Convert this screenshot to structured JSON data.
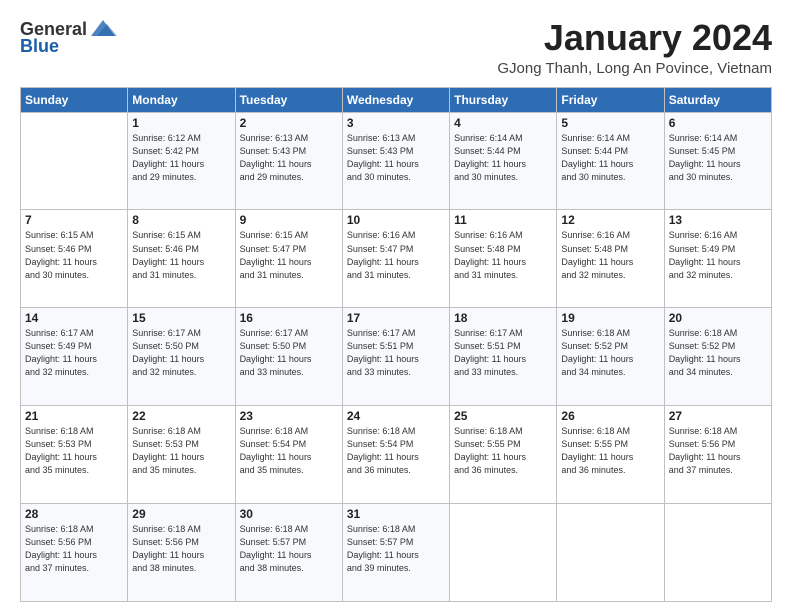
{
  "logo": {
    "general": "General",
    "blue": "Blue"
  },
  "header": {
    "month": "January 2024",
    "location": "GJong Thanh, Long An Povince, Vietnam"
  },
  "weekdays": [
    "Sunday",
    "Monday",
    "Tuesday",
    "Wednesday",
    "Thursday",
    "Friday",
    "Saturday"
  ],
  "weeks": [
    [
      {
        "day": "",
        "info": ""
      },
      {
        "day": "1",
        "info": "Sunrise: 6:12 AM\nSunset: 5:42 PM\nDaylight: 11 hours\nand 29 minutes."
      },
      {
        "day": "2",
        "info": "Sunrise: 6:13 AM\nSunset: 5:43 PM\nDaylight: 11 hours\nand 29 minutes."
      },
      {
        "day": "3",
        "info": "Sunrise: 6:13 AM\nSunset: 5:43 PM\nDaylight: 11 hours\nand 30 minutes."
      },
      {
        "day": "4",
        "info": "Sunrise: 6:14 AM\nSunset: 5:44 PM\nDaylight: 11 hours\nand 30 minutes."
      },
      {
        "day": "5",
        "info": "Sunrise: 6:14 AM\nSunset: 5:44 PM\nDaylight: 11 hours\nand 30 minutes."
      },
      {
        "day": "6",
        "info": "Sunrise: 6:14 AM\nSunset: 5:45 PM\nDaylight: 11 hours\nand 30 minutes."
      }
    ],
    [
      {
        "day": "7",
        "info": "Sunrise: 6:15 AM\nSunset: 5:46 PM\nDaylight: 11 hours\nand 30 minutes."
      },
      {
        "day": "8",
        "info": "Sunrise: 6:15 AM\nSunset: 5:46 PM\nDaylight: 11 hours\nand 31 minutes."
      },
      {
        "day": "9",
        "info": "Sunrise: 6:15 AM\nSunset: 5:47 PM\nDaylight: 11 hours\nand 31 minutes."
      },
      {
        "day": "10",
        "info": "Sunrise: 6:16 AM\nSunset: 5:47 PM\nDaylight: 11 hours\nand 31 minutes."
      },
      {
        "day": "11",
        "info": "Sunrise: 6:16 AM\nSunset: 5:48 PM\nDaylight: 11 hours\nand 31 minutes."
      },
      {
        "day": "12",
        "info": "Sunrise: 6:16 AM\nSunset: 5:48 PM\nDaylight: 11 hours\nand 32 minutes."
      },
      {
        "day": "13",
        "info": "Sunrise: 6:16 AM\nSunset: 5:49 PM\nDaylight: 11 hours\nand 32 minutes."
      }
    ],
    [
      {
        "day": "14",
        "info": "Sunrise: 6:17 AM\nSunset: 5:49 PM\nDaylight: 11 hours\nand 32 minutes."
      },
      {
        "day": "15",
        "info": "Sunrise: 6:17 AM\nSunset: 5:50 PM\nDaylight: 11 hours\nand 32 minutes."
      },
      {
        "day": "16",
        "info": "Sunrise: 6:17 AM\nSunset: 5:50 PM\nDaylight: 11 hours\nand 33 minutes."
      },
      {
        "day": "17",
        "info": "Sunrise: 6:17 AM\nSunset: 5:51 PM\nDaylight: 11 hours\nand 33 minutes."
      },
      {
        "day": "18",
        "info": "Sunrise: 6:17 AM\nSunset: 5:51 PM\nDaylight: 11 hours\nand 33 minutes."
      },
      {
        "day": "19",
        "info": "Sunrise: 6:18 AM\nSunset: 5:52 PM\nDaylight: 11 hours\nand 34 minutes."
      },
      {
        "day": "20",
        "info": "Sunrise: 6:18 AM\nSunset: 5:52 PM\nDaylight: 11 hours\nand 34 minutes."
      }
    ],
    [
      {
        "day": "21",
        "info": "Sunrise: 6:18 AM\nSunset: 5:53 PM\nDaylight: 11 hours\nand 35 minutes."
      },
      {
        "day": "22",
        "info": "Sunrise: 6:18 AM\nSunset: 5:53 PM\nDaylight: 11 hours\nand 35 minutes."
      },
      {
        "day": "23",
        "info": "Sunrise: 6:18 AM\nSunset: 5:54 PM\nDaylight: 11 hours\nand 35 minutes."
      },
      {
        "day": "24",
        "info": "Sunrise: 6:18 AM\nSunset: 5:54 PM\nDaylight: 11 hours\nand 36 minutes."
      },
      {
        "day": "25",
        "info": "Sunrise: 6:18 AM\nSunset: 5:55 PM\nDaylight: 11 hours\nand 36 minutes."
      },
      {
        "day": "26",
        "info": "Sunrise: 6:18 AM\nSunset: 5:55 PM\nDaylight: 11 hours\nand 36 minutes."
      },
      {
        "day": "27",
        "info": "Sunrise: 6:18 AM\nSunset: 5:56 PM\nDaylight: 11 hours\nand 37 minutes."
      }
    ],
    [
      {
        "day": "28",
        "info": "Sunrise: 6:18 AM\nSunset: 5:56 PM\nDaylight: 11 hours\nand 37 minutes."
      },
      {
        "day": "29",
        "info": "Sunrise: 6:18 AM\nSunset: 5:56 PM\nDaylight: 11 hours\nand 38 minutes."
      },
      {
        "day": "30",
        "info": "Sunrise: 6:18 AM\nSunset: 5:57 PM\nDaylight: 11 hours\nand 38 minutes."
      },
      {
        "day": "31",
        "info": "Sunrise: 6:18 AM\nSunset: 5:57 PM\nDaylight: 11 hours\nand 39 minutes."
      },
      {
        "day": "",
        "info": ""
      },
      {
        "day": "",
        "info": ""
      },
      {
        "day": "",
        "info": ""
      }
    ]
  ]
}
